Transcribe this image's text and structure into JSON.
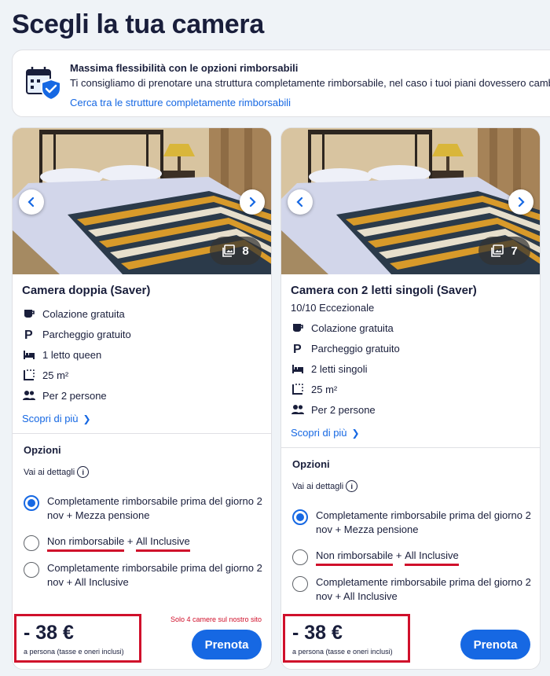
{
  "page": {
    "title": "Scegli la tua camera"
  },
  "banner": {
    "title": "Massima flessibilità con le opzioni rimborsabili",
    "text": "Ti consigliamo di prenotare una struttura completamente rimborsabile, nel caso i tuoi piani dovessero cambiare.",
    "link": "Cerca tra le strutture completamente rimborsabili",
    "icon": "calendar-shield-icon"
  },
  "rooms": [
    {
      "name": "Camera doppia (Saver)",
      "rating": "",
      "photo_count": "8",
      "amenities": [
        {
          "icon": "coffee-cup-icon",
          "label": "Colazione gratuita"
        },
        {
          "icon": "parking-icon",
          "label": "Parcheggio gratuito"
        },
        {
          "icon": "bed-icon",
          "label": "1 letto queen"
        },
        {
          "icon": "room-size-icon",
          "label": "25 m²"
        },
        {
          "icon": "people-icon",
          "label": "Per 2 persone"
        }
      ],
      "more_link": "Scopri di più",
      "options_heading": "Opzioni",
      "details_link": "Vai ai dettagli",
      "options": [
        {
          "label": "Completamente rimborsabile prima del giorno 2 nov + Mezza pensione",
          "selected": true
        },
        {
          "label_a": "Non rimborsabile",
          "sep": " + ",
          "label_b": "All Inclusive",
          "selected": false
        },
        {
          "label": "Completamente rimborsabile prima del giorno 2 nov + All Inclusive",
          "selected": false
        }
      ],
      "availability": "Solo 4 camere sul nostro sito",
      "price": "- 38 €",
      "price_note": "a persona (tasse e oneri inclusi)",
      "book_label": "Prenota"
    },
    {
      "name": "Camera con 2 letti singoli (Saver)",
      "rating": "10/10 Eccezionale",
      "photo_count": "7",
      "amenities": [
        {
          "icon": "coffee-cup-icon",
          "label": "Colazione gratuita"
        },
        {
          "icon": "parking-icon",
          "label": "Parcheggio gratuito"
        },
        {
          "icon": "bed-icon",
          "label": "2 letti singoli"
        },
        {
          "icon": "room-size-icon",
          "label": "25 m²"
        },
        {
          "icon": "people-icon",
          "label": "Per 2 persone"
        }
      ],
      "more_link": "Scopri di più",
      "options_heading": "Opzioni",
      "details_link": "Vai ai dettagli",
      "options": [
        {
          "label": "Completamente rimborsabile prima del giorno 2 nov + Mezza pensione",
          "selected": true
        },
        {
          "label_a": "Non rimborsabile",
          "sep": " + ",
          "label_b": "All Inclusive",
          "selected": false
        },
        {
          "label": "Completamente rimborsabile prima del giorno 2 nov + All Inclusive",
          "selected": false
        }
      ],
      "availability": "",
      "price": "- 38 €",
      "price_note": "a persona (tasse e oneri inclusi)",
      "book_label": "Prenota"
    }
  ],
  "colors": {
    "accent": "#1668e3",
    "highlight": "#d0102b",
    "text": "#191e3b",
    "background": "#eff3f7"
  }
}
